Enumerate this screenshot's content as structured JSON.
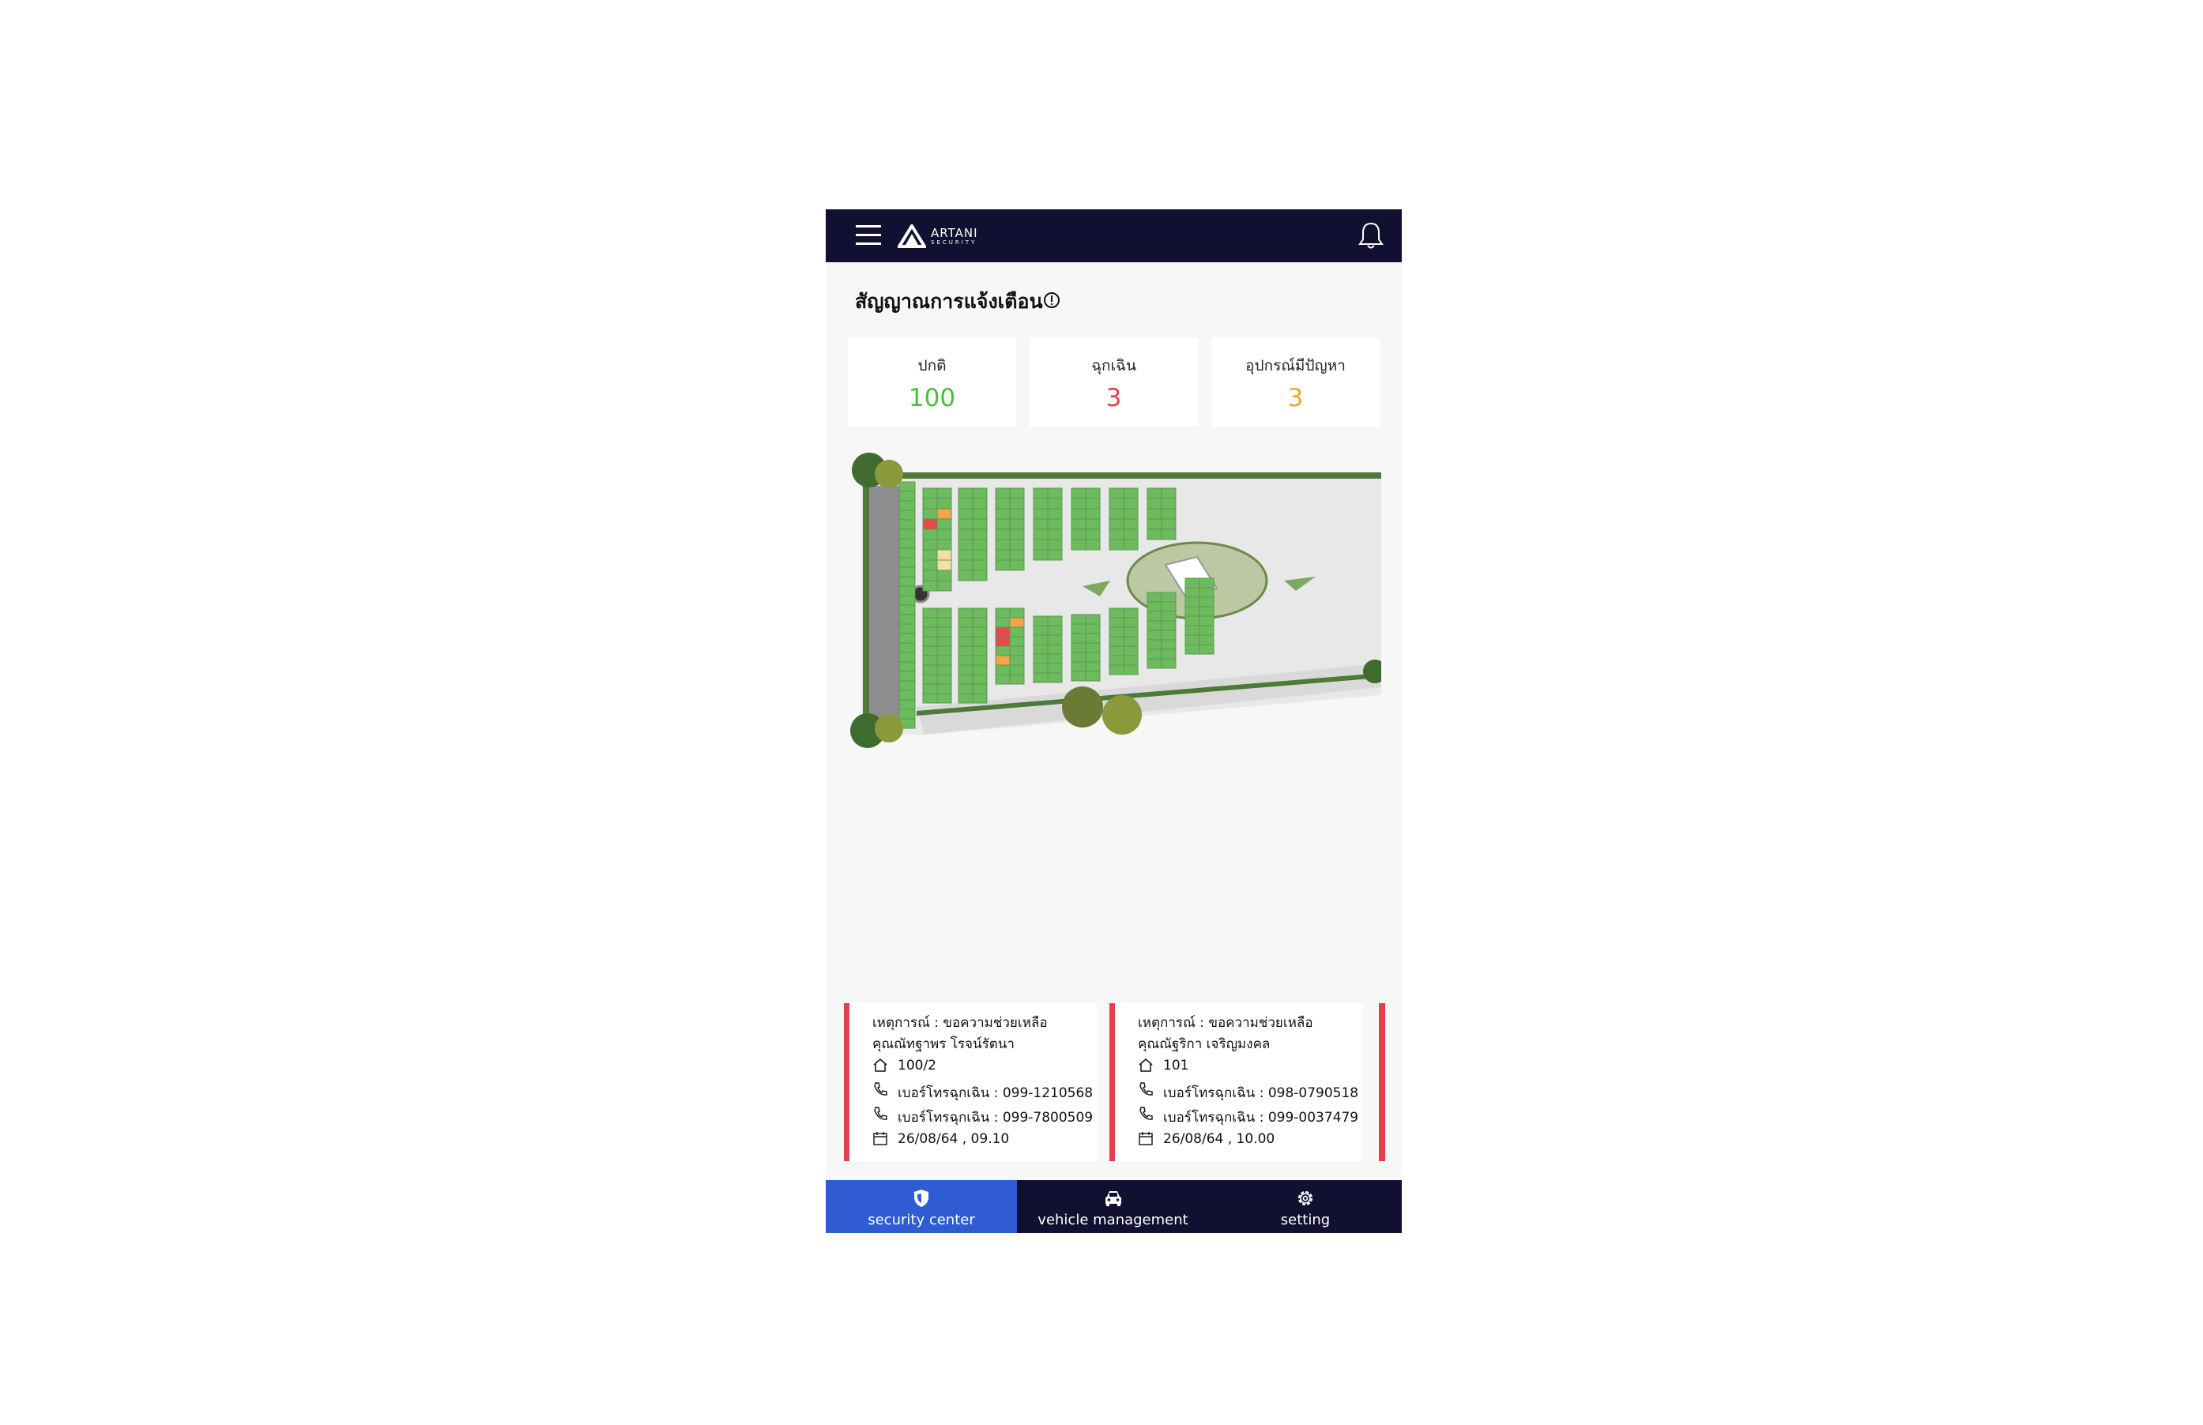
{
  "app": {
    "brand": "ARTANI",
    "brand_sub": "SECURITY"
  },
  "alerts": {
    "title": "สัญญาณการแจ้งเตือน"
  },
  "stats": [
    {
      "label": "ปกติ",
      "value": "100",
      "color": "#49c13a"
    },
    {
      "label": "ฉุกเฉิน",
      "value": "3",
      "color": "#e53e4d"
    },
    {
      "label": "อุปกรณ์มีปัญหา",
      "value": "3",
      "color": "#f5a623"
    }
  ],
  "map": {
    "plot_colors": {
      "normal": "#6ebb5f",
      "emergency": "#e5484d",
      "device_problem": "#f5a44a",
      "vacant": "#f3dfae"
    }
  },
  "incidents": [
    {
      "event": "เหตุการณ์ : ขอความช่วยเหลือ",
      "name": "คุณณัทฐาพร โรจน์รัตนา",
      "house": "100/2",
      "phone1": "เบอร์โทรฉุกเฉิน : 099-1210568",
      "phone2": "เบอร์โทรฉุกเฉิน : 099-7800509",
      "datetime": "26/08/64 , 09.10"
    },
    {
      "event": "เหตุการณ์ : ขอความช่วยเหลือ",
      "name": "คุณณัฐริกา เจริญมงคล",
      "house": "101",
      "phone1": "เบอร์โทรฉุกเฉิน : 098-0790518",
      "phone2": "เบอร์โทรฉุกเฉิน : 099-0037479",
      "datetime": "26/08/64 , 10.00"
    }
  ],
  "nav": [
    {
      "label": "security center",
      "icon": "shield-icon",
      "active": true
    },
    {
      "label": "vehicle management",
      "icon": "car-icon",
      "active": false
    },
    {
      "label": "setting",
      "icon": "gear-icon",
      "active": false
    }
  ],
  "colors": {
    "navbar": "#121032",
    "active_tab": "#2f5bd3",
    "emergency_border": "#e53e4d"
  }
}
